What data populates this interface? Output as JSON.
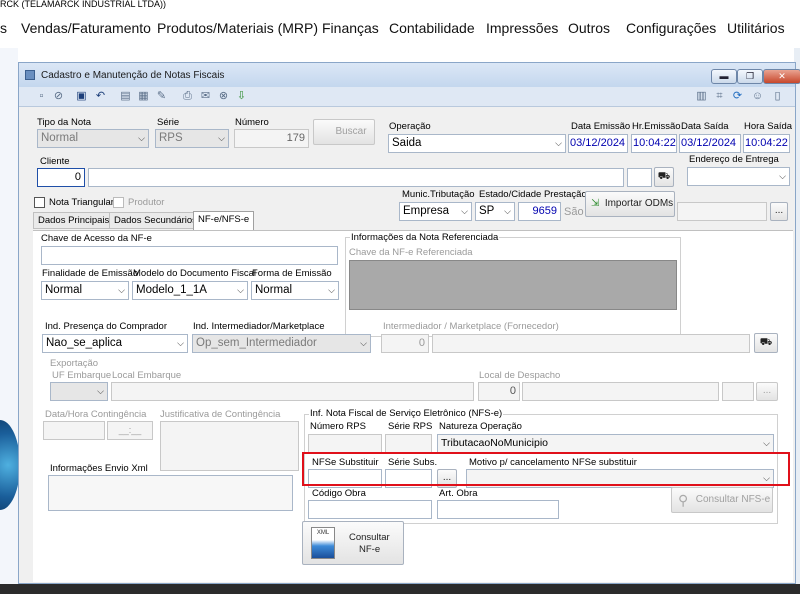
{
  "app": {
    "title_strip": "RCK  (TELAMARCK INDUSTRIAL LTDA))"
  },
  "menu": {
    "items": [
      "s",
      "Vendas/Faturamento",
      "Produtos/Materiais (MRP)",
      "Finanças",
      "Contabilidade",
      "Impressões",
      "Outros",
      "Configurações",
      "Utilitários"
    ]
  },
  "window": {
    "title": "Cadastro e Manutenção de Notas Fiscais",
    "min": "▬",
    "restore": "❐",
    "close": "✕"
  },
  "header": {
    "tipo_nota_label": "Tipo da Nota",
    "tipo_nota_value": "Normal",
    "serie_label": "Série",
    "serie_value": "RPS",
    "numero_label": "Número",
    "numero_value": "179",
    "buscar_label": "Buscar",
    "operacao_label": "Operação",
    "operacao_value": "Saida",
    "data_emissao_label": "Data Emissão",
    "data_emissao_value": "03/12/2024",
    "hr_emissao_label": "Hr.Emissão",
    "hr_emissao_value": "10:04:22",
    "data_saida_label": "Data Saída",
    "data_saida_value": "03/12/2024",
    "hora_saida_label": "Hora Saída",
    "hora_saida_value": "10:04:22",
    "cliente_label": "Cliente",
    "cliente_value": "0",
    "endereco_label": "Endereço de Entrega",
    "nota_triangular_label": "Nota Triangular",
    "produtor_label": "Produtor",
    "munic_label": "Munic.Tributação",
    "munic_value": "Empresa",
    "estado_label": "Estado/Cidade Prestação S",
    "estado_value": "SP",
    "cidade_code": "9659",
    "cidade_name": "São",
    "importar_label": "Importar ODMs"
  },
  "tabs": [
    "Dados Principais",
    "Dados Secundários",
    "NF-e/NFS-e"
  ],
  "nfe": {
    "chave_label": "Chave de Acesso da NF-e",
    "finalidade_label": "Finalidade de Emissão",
    "finalidade_value": "Normal",
    "modelo_label": "Modelo do Documento Fiscal",
    "modelo_value": "Modelo_1_1A",
    "forma_label": "Forma de Emissão",
    "forma_value": "Normal",
    "info_ref_label": "Informações da Nota Referenciada",
    "chave_ref_label": "Chave da NF-e Referenciada",
    "presenca_label": "Ind. Presença do Comprador",
    "presenca_value": "Nao_se_aplica",
    "intermediador_label": "Ind. Intermediador/Marketplace",
    "intermediador_value": "Op_sem_Intermediador",
    "marketplace_label": "Intermediador / Marketplace (Fornecedor)",
    "marketplace_value": "0",
    "exportacao_label": "Exportação",
    "uf_label": "UF Embarque",
    "local_emb_label": "Local Embarque",
    "local_desp_label": "Local de Despacho",
    "local_desp_value": "0",
    "data_cont_label": "Data/Hora Contingência",
    "data_cont_value": "__:__",
    "just_cont_label": "Justificativa de Contingência",
    "info_xml_label": "Informações Envio Xml"
  },
  "nfse": {
    "group_label": "Inf. Nota Fiscal de Serviço Eletrônico (NFS-e)",
    "numero_rps_label": "Número RPS",
    "serie_rps_label": "Série RPS",
    "natureza_label": "Natureza Operação",
    "natureza_value": "TributacaoNoMunicipio",
    "substituir_label": "NFSe Substituir",
    "serie_subs_label": "Série Subs.",
    "ellipsis": "...",
    "motivo_label": "Motivo p/ cancelamento NFSe substituir",
    "codigo_obra_label": "Código Obra",
    "art_obra_label": "Art. Obra",
    "consultar_nfse_label": "Consultar NFS-e",
    "consultar_nfe_label1": "Consultar",
    "consultar_nfe_label2": "NF-e",
    "xml_tag": "XML"
  },
  "colors": {
    "highlight": "#e0101a",
    "field_blue": "#0000b0"
  }
}
